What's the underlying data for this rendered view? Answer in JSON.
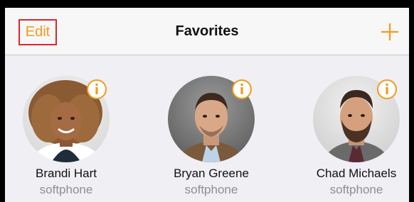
{
  "navbar": {
    "edit_label": "Edit",
    "title": "Favorites",
    "add_icon": "plus-icon"
  },
  "accent_color": "#f39a1e",
  "favorites": [
    {
      "name": "Brandi Hart",
      "type": "softphone"
    },
    {
      "name": "Bryan Greene",
      "type": "softphone"
    },
    {
      "name": "Chad Michaels",
      "type": "softphone"
    }
  ]
}
